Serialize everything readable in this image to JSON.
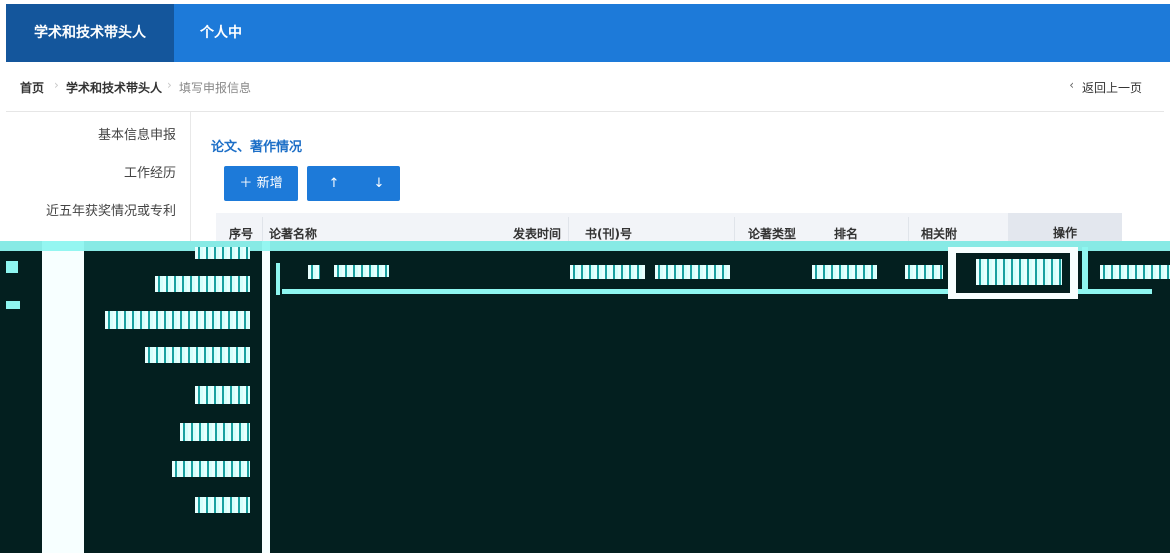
{
  "topnav": {
    "tabs": [
      {
        "label": "学术和技术带头人",
        "active": true
      },
      {
        "label": "个人中心",
        "active": false
      }
    ]
  },
  "breadcrumb": {
    "items": [
      "首页",
      "学术和技术带头人",
      "填写申报信息"
    ],
    "back_label": "返回上一页"
  },
  "sidebar": {
    "items": [
      "基本信息申报",
      "工作经历",
      "近五年获奖情况或专利"
    ]
  },
  "main": {
    "section_title": "论文、著作情况",
    "add_button": "新增",
    "up_icon": "arrow-up-icon",
    "down_icon": "arrow-down-icon",
    "table": {
      "columns": [
        "序号",
        "论著名称",
        "发表时间",
        "书(刊)号",
        "论著类型",
        "排名",
        "相关附",
        "操作"
      ]
    }
  },
  "colors": {
    "primary": "#1d7ad9",
    "primary_dark": "#14569c",
    "glitch_bg": "#031f1f",
    "glitch_cyan": "#8ef6f0"
  }
}
